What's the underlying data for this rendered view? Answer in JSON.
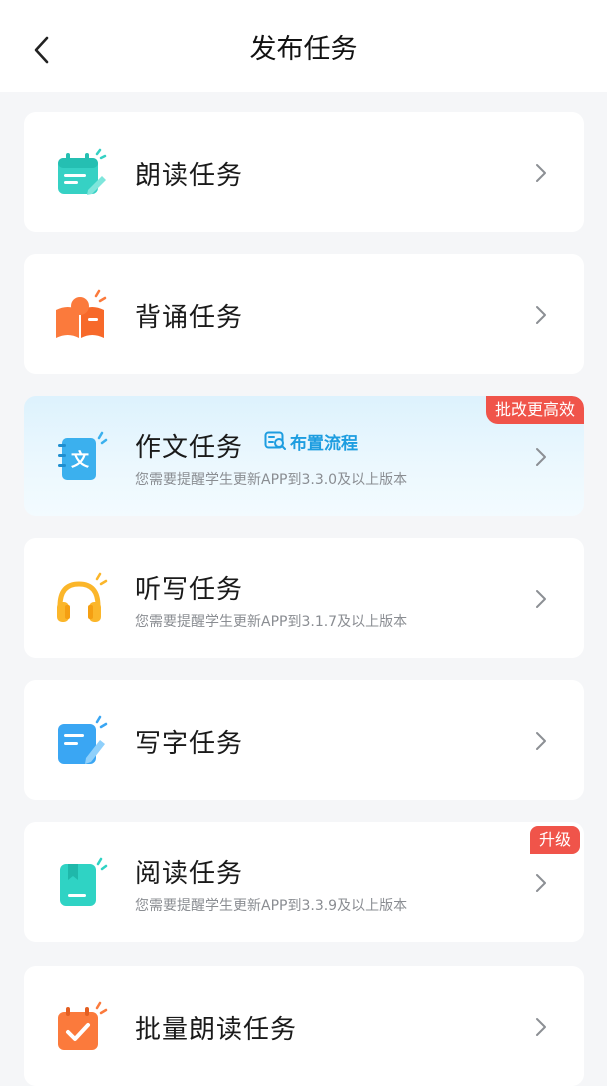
{
  "header": {
    "title": "发布任务",
    "back_icon": "chevron-left-icon"
  },
  "tasks": [
    {
      "title": "朗读任务",
      "subtitle": "",
      "icon": "read-aloud-icon",
      "icon_color": "#36d1c4"
    },
    {
      "title": "背诵任务",
      "subtitle": "",
      "icon": "recite-book-icon",
      "icon_color": "#fb7a3c"
    },
    {
      "title": "作文任务",
      "subtitle": "您需要提醒学生更新APP到3.3.0及以上版本",
      "icon": "composition-notebook-icon",
      "icon_color": "#3bb0ee",
      "badge": "批改更高效",
      "link": "布置流程",
      "link_icon": "flow-guide-icon"
    },
    {
      "title": "听写任务",
      "subtitle": "您需要提醒学生更新APP到3.1.7及以上版本",
      "icon": "headphones-icon",
      "icon_color": "#fbb62a"
    },
    {
      "title": "写字任务",
      "subtitle": "",
      "icon": "writing-pen-icon",
      "icon_color": "#3aa6f3"
    },
    {
      "title": "阅读任务",
      "subtitle": "您需要提醒学生更新APP到3.3.9及以上版本",
      "icon": "reading-book-icon",
      "icon_color": "#2fd3c4",
      "badge": "升级"
    },
    {
      "title": "批量朗读任务",
      "subtitle": "",
      "icon": "batch-calendar-check-icon",
      "icon_color": "#fb7a3c"
    }
  ],
  "colors": {
    "badge": "#f0544a",
    "link": "#1d9de0",
    "highlight_bg": "#e4f5fe"
  }
}
